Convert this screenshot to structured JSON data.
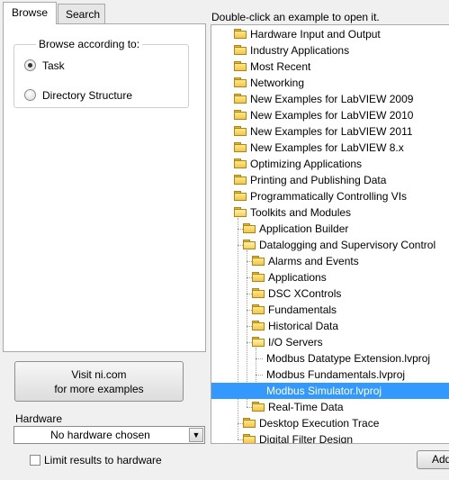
{
  "tabs": [
    {
      "label": "Browse",
      "active": true
    },
    {
      "label": "Search",
      "active": false
    }
  ],
  "browse_group": {
    "legend": "Browse according to:",
    "options": [
      {
        "label": "Task",
        "selected": true
      },
      {
        "label": "Directory Structure",
        "selected": false
      }
    ]
  },
  "visit_button": {
    "line1": "Visit ni.com",
    "line2": "for more examples"
  },
  "hardware": {
    "label": "Hardware",
    "selected": "No hardware chosen"
  },
  "limit_checkbox": {
    "label": "Limit results to hardware",
    "checked": false
  },
  "instructions": "Double-click an example to open it.",
  "tree": {
    "rows": [
      {
        "label": "Hardware Input and Output",
        "depth": 0,
        "type": "folder"
      },
      {
        "label": "Industry Applications",
        "depth": 0,
        "type": "folder"
      },
      {
        "label": "Most Recent",
        "depth": 0,
        "type": "folder"
      },
      {
        "label": "Networking",
        "depth": 0,
        "type": "folder"
      },
      {
        "label": "New Examples for LabVIEW 2009",
        "depth": 0,
        "type": "folder"
      },
      {
        "label": "New Examples for LabVIEW 2010",
        "depth": 0,
        "type": "folder"
      },
      {
        "label": "New Examples for LabVIEW 2011",
        "depth": 0,
        "type": "folder"
      },
      {
        "label": "New Examples for LabVIEW 8.x",
        "depth": 0,
        "type": "folder"
      },
      {
        "label": "Optimizing Applications",
        "depth": 0,
        "type": "folder"
      },
      {
        "label": "Printing and Publishing Data",
        "depth": 0,
        "type": "folder"
      },
      {
        "label": "Programmatically Controlling VIs",
        "depth": 0,
        "type": "folder"
      },
      {
        "label": "Toolkits and Modules",
        "depth": 0,
        "type": "folder-open"
      },
      {
        "label": "Application Builder",
        "depth": 1,
        "type": "folder"
      },
      {
        "label": "Datalogging and Supervisory Control",
        "depth": 1,
        "type": "folder-open"
      },
      {
        "label": "Alarms and Events",
        "depth": 2,
        "type": "folder"
      },
      {
        "label": "Applications",
        "depth": 2,
        "type": "folder"
      },
      {
        "label": "DSC XControls",
        "depth": 2,
        "type": "folder"
      },
      {
        "label": "Fundamentals",
        "depth": 2,
        "type": "folder"
      },
      {
        "label": "Historical Data",
        "depth": 2,
        "type": "folder"
      },
      {
        "label": "I/O Servers",
        "depth": 2,
        "type": "folder-open"
      },
      {
        "label": "Modbus Datatype Extension.lvproj",
        "depth": 3,
        "type": "file"
      },
      {
        "label": "Modbus Fundamentals.lvproj",
        "depth": 3,
        "type": "file"
      },
      {
        "label": "Modbus Simulator.lvproj",
        "depth": 3,
        "type": "file",
        "selected": true
      },
      {
        "label": "Real-Time Data",
        "depth": 2,
        "type": "folder"
      },
      {
        "label": "Desktop Execution Trace",
        "depth": 1,
        "type": "folder"
      },
      {
        "label": "Digital Filter Design",
        "depth": 1,
        "type": "folder"
      }
    ]
  },
  "add_button": {
    "label": "Add"
  },
  "colors": {
    "selection": "#3399ff",
    "folder": "#f2c64a"
  }
}
